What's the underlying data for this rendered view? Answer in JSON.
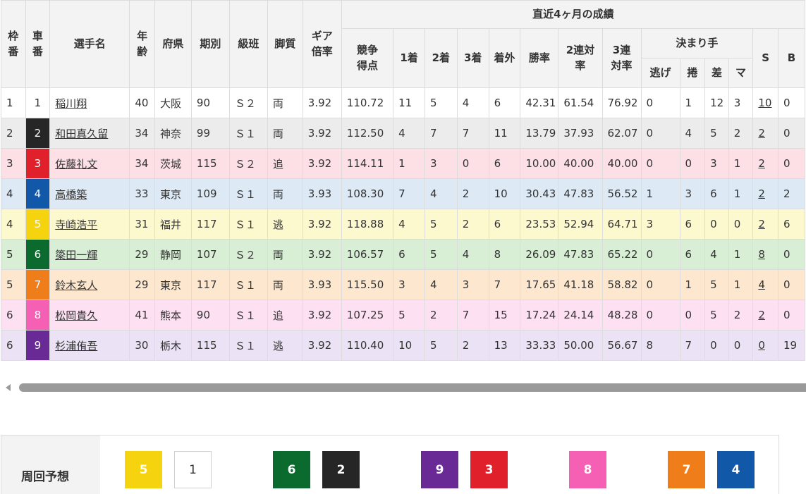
{
  "headers": {
    "waku": "枠番",
    "car": "車番",
    "name": "選手名",
    "age": "年齢",
    "pref": "府県",
    "term": "期別",
    "class": "級班",
    "leg": "脚質",
    "gear": "ギア倍率",
    "recent": "直近4ヶ月の成績",
    "score": "競争得点",
    "first": "1着",
    "second": "2着",
    "third": "3着",
    "out": "着外",
    "win_rate": "勝率",
    "top2": "2連対率",
    "top3": "3連対率",
    "kimarite": "決まり手",
    "nige": "逃げ",
    "makuri": "捲",
    "sashi": "差",
    "mark": "マ",
    "s": "S",
    "b": "B"
  },
  "car_colors": {
    "1": {
      "bg": "#ffffff",
      "fg": "#333333"
    },
    "2": {
      "bg": "#262626",
      "fg": "#ffffff"
    },
    "3": {
      "bg": "#e0202a",
      "fg": "#ffffff"
    },
    "4": {
      "bg": "#1258a8",
      "fg": "#ffffff"
    },
    "5": {
      "bg": "#f5d30f",
      "fg": "#ffffff"
    },
    "6": {
      "bg": "#0b6b2e",
      "fg": "#ffffff"
    },
    "7": {
      "bg": "#ee7d1a",
      "fg": "#ffffff"
    },
    "8": {
      "bg": "#f55fb4",
      "fg": "#ffffff"
    },
    "9": {
      "bg": "#6a2a96",
      "fg": "#ffffff"
    }
  },
  "rows": [
    {
      "waku": "1",
      "car": "1",
      "name": "稲川翔",
      "age": "40",
      "pref": "大阪",
      "term": "90",
      "class": "Ｓ２",
      "leg": "両",
      "gear": "3.92",
      "score": "110.72",
      "first": "11",
      "second": "5",
      "third": "4",
      "out": "6",
      "win": "42.31",
      "top2": "61.54",
      "top3": "76.92",
      "nige": "0",
      "makuri": "1",
      "sashi": "12",
      "mark": "3",
      "s": "10",
      "b": "0",
      "bg": "#ffffff"
    },
    {
      "waku": "2",
      "car": "2",
      "name": "和田真久留",
      "age": "34",
      "pref": "神奈",
      "term": "99",
      "class": "Ｓ１",
      "leg": "両",
      "gear": "3.92",
      "score": "112.50",
      "first": "4",
      "second": "7",
      "third": "7",
      "out": "11",
      "win": "13.79",
      "top2": "37.93",
      "top3": "62.07",
      "nige": "0",
      "makuri": "4",
      "sashi": "5",
      "mark": "2",
      "s": "2",
      "b": "0",
      "bg": "#ececec"
    },
    {
      "waku": "3",
      "car": "3",
      "name": "佐藤礼文",
      "age": "34",
      "pref": "茨城",
      "term": "115",
      "class": "Ｓ２",
      "leg": "追",
      "gear": "3.92",
      "score": "114.11",
      "first": "1",
      "second": "3",
      "third": "0",
      "out": "6",
      "win": "10.00",
      "top2": "40.00",
      "top3": "40.00",
      "nige": "0",
      "makuri": "0",
      "sashi": "3",
      "mark": "1",
      "s": "2",
      "b": "0",
      "bg": "#fde0e6"
    },
    {
      "waku": "4",
      "car": "4",
      "name": "高橋築",
      "age": "33",
      "pref": "東京",
      "term": "109",
      "class": "Ｓ１",
      "leg": "両",
      "gear": "3.93",
      "score": "108.30",
      "first": "7",
      "second": "4",
      "third": "2",
      "out": "10",
      "win": "30.43",
      "top2": "47.83",
      "top3": "56.52",
      "nige": "1",
      "makuri": "3",
      "sashi": "6",
      "mark": "1",
      "s": "2",
      "b": "2",
      "bg": "#dde9f5"
    },
    {
      "waku": "4",
      "car": "5",
      "name": "寺崎浩平",
      "age": "31",
      "pref": "福井",
      "term": "117",
      "class": "Ｓ１",
      "leg": "逃",
      "gear": "3.92",
      "score": "118.88",
      "first": "4",
      "second": "5",
      "third": "2",
      "out": "6",
      "win": "23.53",
      "top2": "52.94",
      "top3": "64.71",
      "nige": "3",
      "makuri": "6",
      "sashi": "0",
      "mark": "0",
      "s": "2",
      "b": "6",
      "bg": "#fdf9cf"
    },
    {
      "waku": "5",
      "car": "6",
      "name": "簗田一輝",
      "age": "29",
      "pref": "静岡",
      "term": "107",
      "class": "Ｓ２",
      "leg": "両",
      "gear": "3.92",
      "score": "106.57",
      "first": "6",
      "second": "5",
      "third": "4",
      "out": "8",
      "win": "26.09",
      "top2": "47.83",
      "top3": "65.22",
      "nige": "0",
      "makuri": "6",
      "sashi": "4",
      "mark": "1",
      "s": "8",
      "b": "0",
      "bg": "#d8efd6"
    },
    {
      "waku": "5",
      "car": "7",
      "name": "鈴木玄人",
      "age": "29",
      "pref": "東京",
      "term": "117",
      "class": "Ｓ１",
      "leg": "両",
      "gear": "3.93",
      "score": "115.50",
      "first": "3",
      "second": "4",
      "third": "3",
      "out": "7",
      "win": "17.65",
      "top2": "41.18",
      "top3": "58.82",
      "nige": "0",
      "makuri": "1",
      "sashi": "5",
      "mark": "1",
      "s": "4",
      "b": "0",
      "bg": "#fde8cf"
    },
    {
      "waku": "6",
      "car": "8",
      "name": "松岡貴久",
      "age": "41",
      "pref": "熊本",
      "term": "90",
      "class": "Ｓ１",
      "leg": "追",
      "gear": "3.92",
      "score": "107.25",
      "first": "5",
      "second": "2",
      "third": "7",
      "out": "15",
      "win": "17.24",
      "top2": "24.14",
      "top3": "48.28",
      "nige": "0",
      "makuri": "0",
      "sashi": "5",
      "mark": "2",
      "s": "2",
      "b": "0",
      "bg": "#fde0f2"
    },
    {
      "waku": "6",
      "car": "9",
      "name": "杉浦侑吾",
      "age": "30",
      "pref": "栃木",
      "term": "115",
      "class": "Ｓ１",
      "leg": "逃",
      "gear": "3.92",
      "score": "110.40",
      "first": "10",
      "second": "5",
      "third": "2",
      "out": "13",
      "win": "33.33",
      "top2": "50.00",
      "top3": "56.67",
      "nige": "8",
      "makuri": "7",
      "sashi": "0",
      "mark": "0",
      "s": "0",
      "b": "19",
      "bg": "#ebe3f5"
    }
  ],
  "prediction": {
    "label": "周回予想",
    "boxes": [
      "5",
      "1",
      "6",
      "2",
      "9",
      "3",
      "8",
      "7",
      "4"
    ]
  }
}
